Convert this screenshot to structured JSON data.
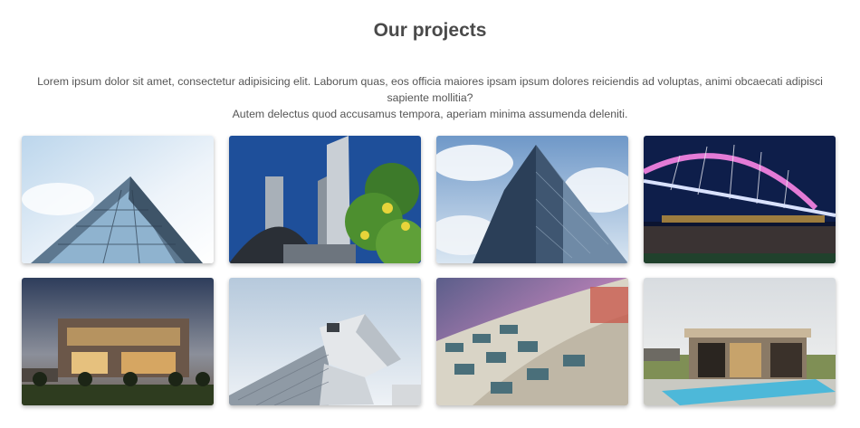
{
  "section": {
    "title": "Our projects",
    "lead_line1": "Lorem ipsum dolor sit amet, consectetur adipisicing elit. Laborum quas, eos officia maiores ipsam ipsum dolores reiciendis ad voluptas, animi obcaecati adipisci sapiente mollitia?",
    "lead_line2": "Autem delectus quod accusamus tempora, aperiam minima assumenda deleniti."
  },
  "projects": [
    {
      "icon": "glass-building-photo"
    },
    {
      "icon": "city-hall-towers-photo"
    },
    {
      "icon": "skyscraper-clouds-photo"
    },
    {
      "icon": "arch-bridge-night-photo"
    },
    {
      "icon": "building-dusk-photo"
    },
    {
      "icon": "angular-museum-photo"
    },
    {
      "icon": "curved-apartments-photo"
    },
    {
      "icon": "modern-house-pool-photo"
    }
  ]
}
